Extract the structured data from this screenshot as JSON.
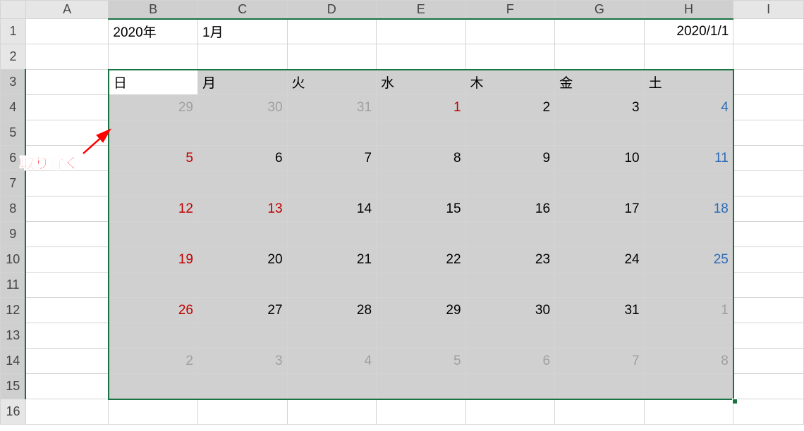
{
  "columns": [
    "A",
    "B",
    "C",
    "D",
    "E",
    "F",
    "G",
    "H",
    "I"
  ],
  "rows": [
    "1",
    "2",
    "3",
    "4",
    "5",
    "6",
    "7",
    "8",
    "9",
    "10",
    "11",
    "12",
    "13",
    "14",
    "15",
    "16"
  ],
  "header_year": "2020年",
  "header_month": "1月",
  "header_date": "2020/1/1",
  "weekdays": [
    "日",
    "月",
    "火",
    "水",
    "木",
    "金",
    "土"
  ],
  "calendar": [
    [
      {
        "v": "29",
        "c": "gray"
      },
      {
        "v": "30",
        "c": "gray"
      },
      {
        "v": "31",
        "c": "gray"
      },
      {
        "v": "1",
        "c": "red"
      },
      {
        "v": "2",
        "c": "black"
      },
      {
        "v": "3",
        "c": "black"
      },
      {
        "v": "4",
        "c": "blue"
      }
    ],
    [
      {
        "v": "5",
        "c": "red"
      },
      {
        "v": "6",
        "c": "black"
      },
      {
        "v": "7",
        "c": "black"
      },
      {
        "v": "8",
        "c": "black"
      },
      {
        "v": "9",
        "c": "black"
      },
      {
        "v": "10",
        "c": "black"
      },
      {
        "v": "11",
        "c": "blue"
      }
    ],
    [
      {
        "v": "12",
        "c": "red"
      },
      {
        "v": "13",
        "c": "red"
      },
      {
        "v": "14",
        "c": "black"
      },
      {
        "v": "15",
        "c": "black"
      },
      {
        "v": "16",
        "c": "black"
      },
      {
        "v": "17",
        "c": "black"
      },
      {
        "v": "18",
        "c": "blue"
      }
    ],
    [
      {
        "v": "19",
        "c": "red"
      },
      {
        "v": "20",
        "c": "black"
      },
      {
        "v": "21",
        "c": "black"
      },
      {
        "v": "22",
        "c": "black"
      },
      {
        "v": "23",
        "c": "black"
      },
      {
        "v": "24",
        "c": "black"
      },
      {
        "v": "25",
        "c": "blue"
      }
    ],
    [
      {
        "v": "26",
        "c": "red"
      },
      {
        "v": "27",
        "c": "black"
      },
      {
        "v": "28",
        "c": "black"
      },
      {
        "v": "29",
        "c": "black"
      },
      {
        "v": "30",
        "c": "black"
      },
      {
        "v": "31",
        "c": "black"
      },
      {
        "v": "1",
        "c": "gray"
      }
    ],
    [
      {
        "v": "2",
        "c": "gray"
      },
      {
        "v": "3",
        "c": "gray"
      },
      {
        "v": "4",
        "c": "gray"
      },
      {
        "v": "5",
        "c": "gray"
      },
      {
        "v": "6",
        "c": "gray"
      },
      {
        "v": "7",
        "c": "gray"
      },
      {
        "v": "8",
        "c": "gray"
      }
    ]
  ],
  "annotation": "取り除く"
}
